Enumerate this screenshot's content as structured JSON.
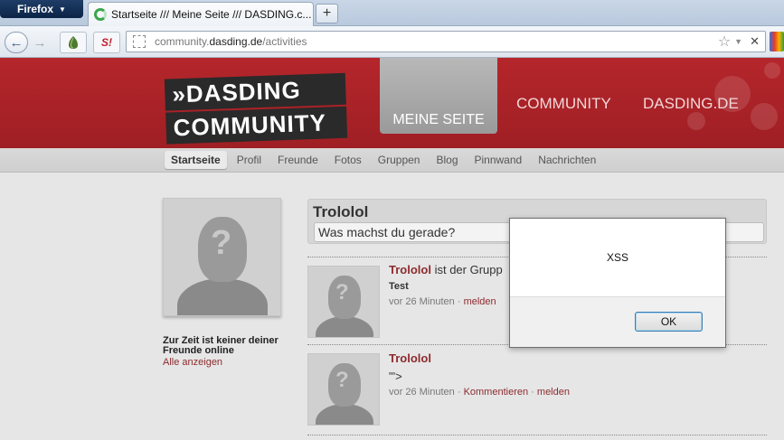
{
  "browser": {
    "menu_button": "Firefox",
    "tab_title": "Startseite /// Meine Seite /// DASDING.c...",
    "new_tab": "+",
    "back": "←",
    "forward": "→",
    "url_host": "community.dasding.de",
    "url_host_prefix": "community.",
    "url_host_bold": "dasding.de",
    "url_path": "/activities",
    "addon2_label": "S!"
  },
  "header": {
    "logo_line1": "»DASDING",
    "logo_line2": "COMMUNITY",
    "nav_meine_seite": "MEINE SEITE",
    "nav_community": "COMMUNITY",
    "nav_dasding": "DASDING.DE"
  },
  "subnav": {
    "items": [
      "Startseite",
      "Profil",
      "Freunde",
      "Fotos",
      "Gruppen",
      "Blog",
      "Pinnwand",
      "Nachrichten"
    ],
    "active": "Startseite"
  },
  "sidebar": {
    "online_text": "Zur Zeit ist keiner deiner Freunde online",
    "show_all": "Alle anzeigen"
  },
  "status": {
    "user": "Trololol",
    "placeholder": "Was machst du gerade?"
  },
  "feed": [
    {
      "user": "Trololol",
      "action": "ist der Grupp",
      "text": "Test",
      "time": "vor 26 Minuten",
      "sep": "·",
      "link1": "melden",
      "link2": ""
    },
    {
      "user": "Trololol",
      "action": "",
      "text": "\"'>",
      "time": "vor 26 Minuten",
      "sep": "·",
      "link1": "Kommentieren",
      "link2": "melden"
    }
  ],
  "dialog": {
    "message": "XSS",
    "ok_label": "OK"
  },
  "colors": {
    "header_red": "#b4262b",
    "link_red": "#8c2b2e",
    "tab_green": "#3aa54a"
  }
}
